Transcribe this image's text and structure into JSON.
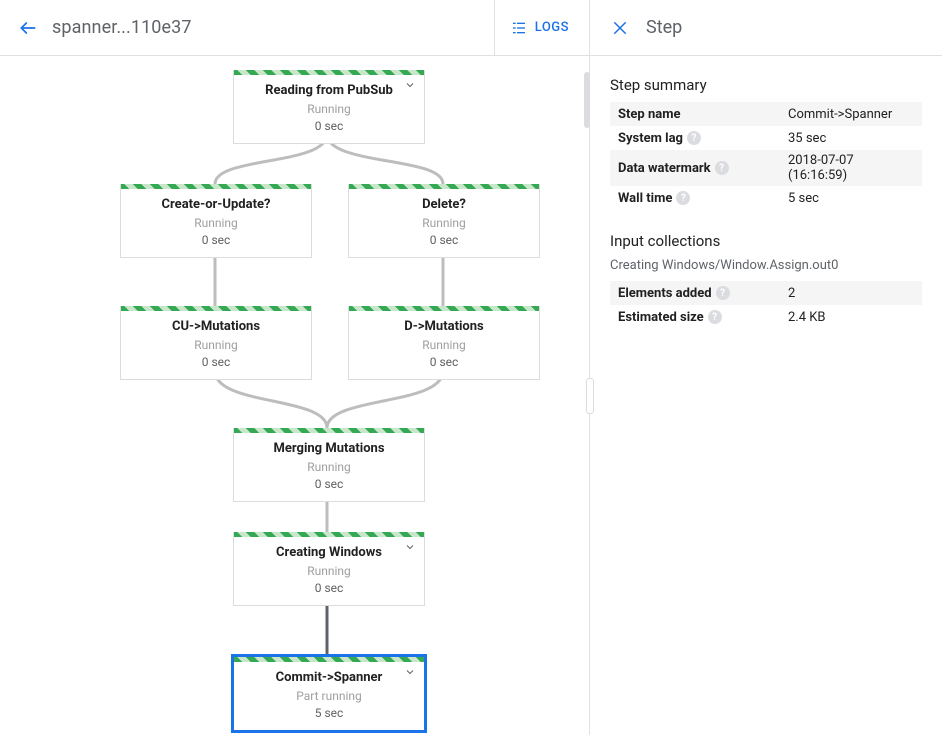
{
  "header": {
    "job_title": "spanner...110e37",
    "logs_label": "LOGS"
  },
  "side_panel": {
    "title": "Step",
    "summary_title": "Step summary",
    "summary": [
      {
        "k": "Step name",
        "v": "Commit->Spanner",
        "help": false
      },
      {
        "k": "System lag",
        "v": "35 sec",
        "help": true
      },
      {
        "k": "Data watermark",
        "v": "2018-07-07 (16:16:59)",
        "help": true
      },
      {
        "k": "Wall time",
        "v": "5 sec",
        "help": true
      }
    ],
    "inputs_title": "Input collections",
    "inputs_subhead": "Creating Windows/Window.Assign.out0",
    "inputs": [
      {
        "k": "Elements added",
        "v": "2",
        "help": true
      },
      {
        "k": "Estimated size",
        "v": "2.4 KB",
        "help": true
      }
    ]
  },
  "graph": {
    "nodes": {
      "read": {
        "title": "Reading from PubSub",
        "status": "Running",
        "time": "0 sec",
        "expandable": true
      },
      "create": {
        "title": "Create-or-Update?",
        "status": "Running",
        "time": "0 sec",
        "expandable": false
      },
      "delete": {
        "title": "Delete?",
        "status": "Running",
        "time": "0 sec",
        "expandable": false
      },
      "cumut": {
        "title": "CU->Mutations",
        "status": "Running",
        "time": "0 sec",
        "expandable": false
      },
      "dmut": {
        "title": "D->Mutations",
        "status": "Running",
        "time": "0 sec",
        "expandable": false
      },
      "merge": {
        "title": "Merging Mutations",
        "status": "Running",
        "time": "0 sec",
        "expandable": false
      },
      "wind": {
        "title": "Creating Windows",
        "status": "Running",
        "time": "0 sec",
        "expandable": true
      },
      "commit": {
        "title": "Commit->Spanner",
        "status": "Part running",
        "time": "5 sec",
        "expandable": true,
        "selected": true
      }
    }
  }
}
